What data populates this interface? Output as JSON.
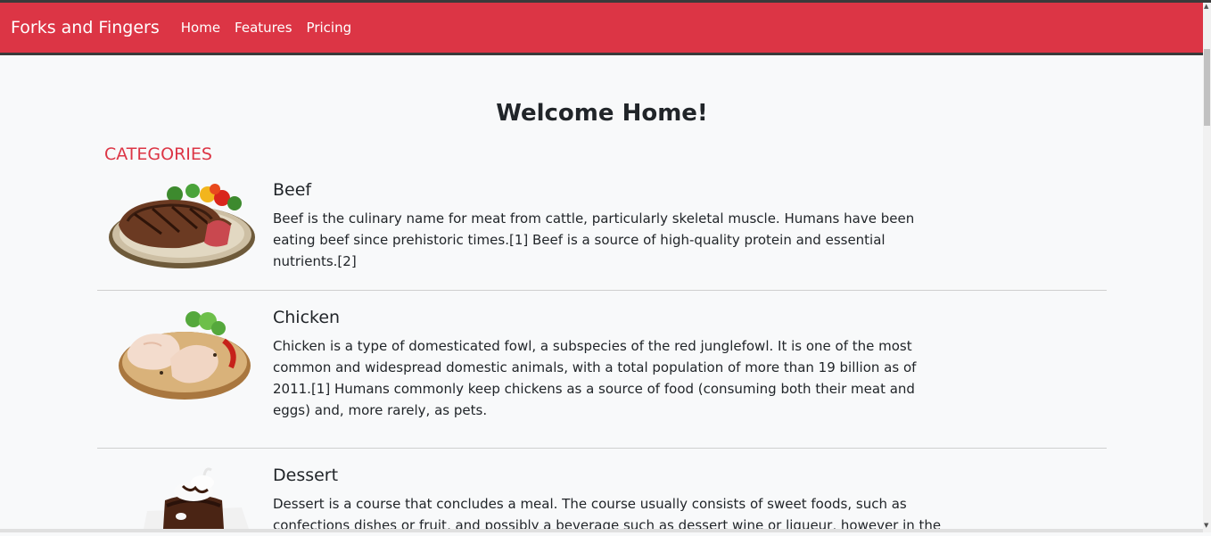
{
  "navbar": {
    "brand": "Forks and Fingers",
    "links": [
      "Home",
      "Features",
      "Pricing"
    ],
    "color": "#dc3545"
  },
  "main": {
    "heading": "Welcome Home!",
    "categories_heading": "CATEGORIES",
    "categories": [
      {
        "title": "Beef",
        "image_icon": "grilled-steak-plate",
        "description": "Beef is the culinary name for meat from cattle, particularly skeletal muscle. Humans have been eating beef since prehistoric times.[1] Beef is a source of high-quality protein and essential nutrients.[2]"
      },
      {
        "title": "Chicken",
        "image_icon": "raw-chicken-board",
        "description": "Chicken is a type of domesticated fowl, a subspecies of the red junglefowl. It is one of the most common and widespread domestic animals, with a total population of more than 19 billion as of 2011.[1] Humans commonly keep chickens as a source of food (consuming both their meat and eggs) and, more rarely, as pets."
      },
      {
        "title": "Dessert",
        "image_icon": "chocolate-cake-dessert",
        "description": "Dessert is a course that concludes a meal. The course usually consists of sweet foods, such as confections dishes or fruit, and possibly a beverage such as dessert wine or liqueur, however in the"
      }
    ]
  }
}
